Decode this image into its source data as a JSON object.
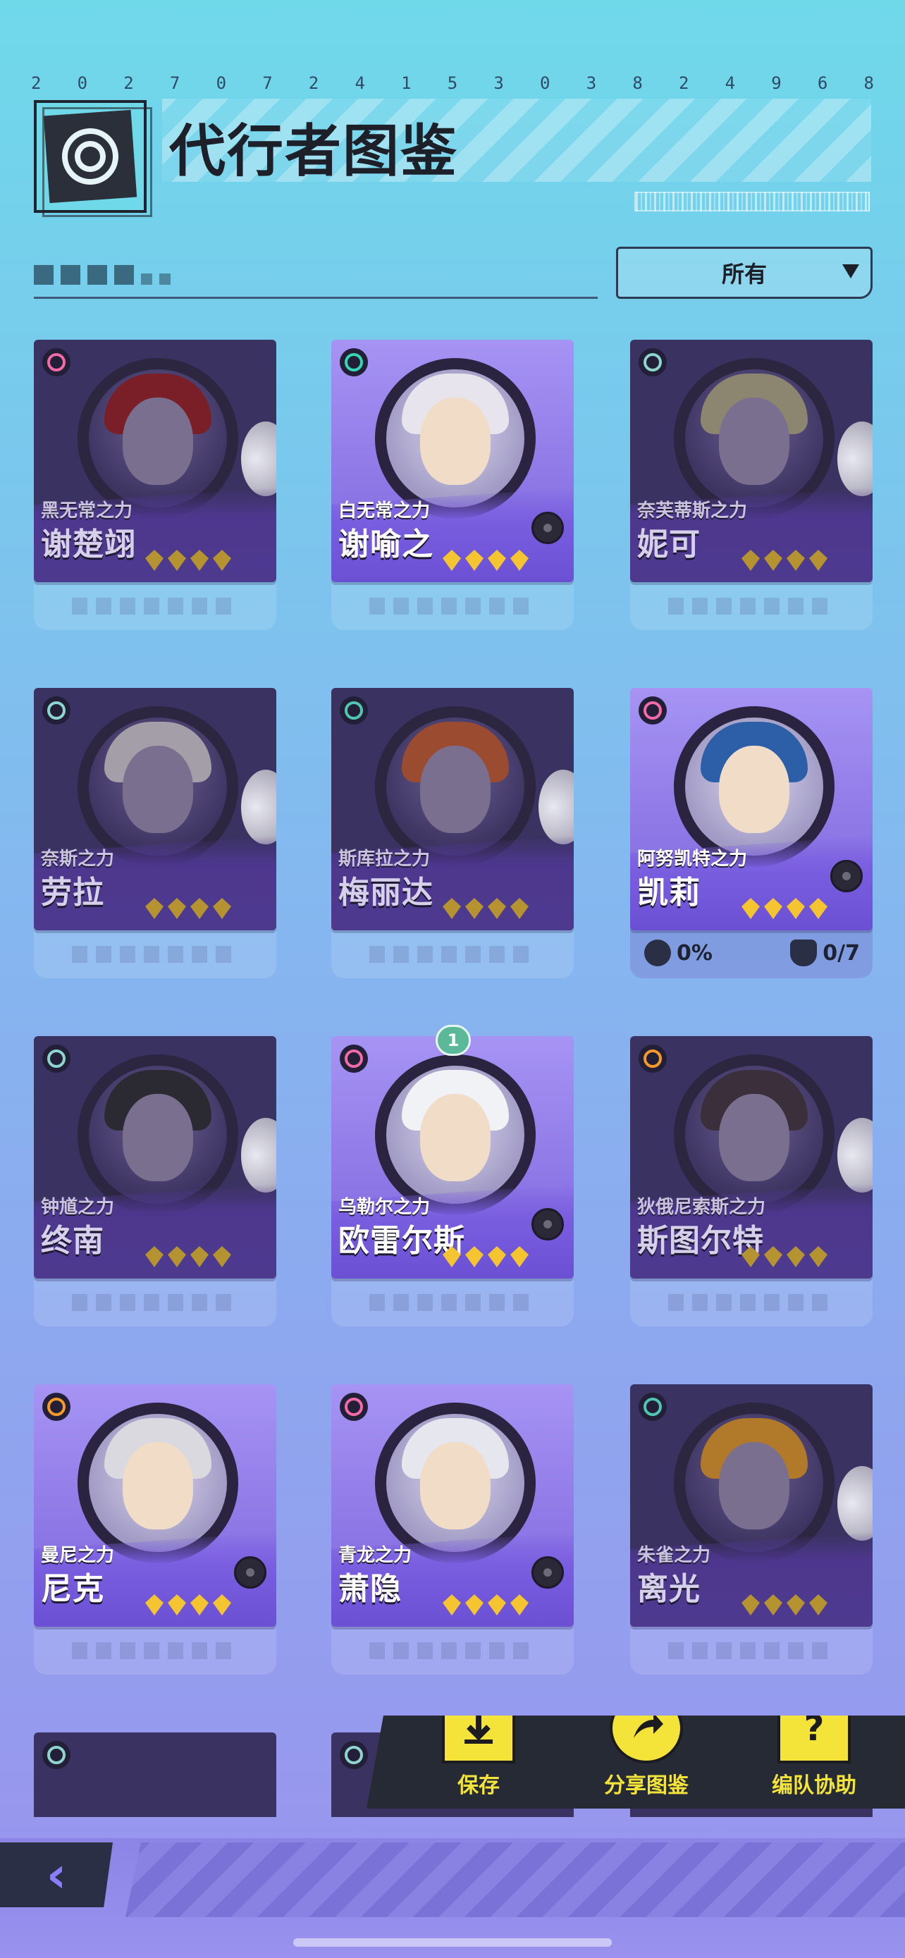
{
  "header": {
    "code": [
      "2",
      "0",
      "2",
      "7",
      "0",
      "7",
      "2",
      "4",
      "1",
      "5",
      "3",
      "0",
      "3",
      "8",
      "2",
      "4",
      "9",
      "6",
      "8"
    ],
    "title": "代行者图鉴"
  },
  "filter": {
    "selected": "所有"
  },
  "cards": [
    {
      "power": "黑无常之力",
      "name": "谢楚翊",
      "owned": false,
      "element": "pink",
      "hair": "#7a1f28"
    },
    {
      "power": "白无常之力",
      "name": "谢喻之",
      "owned": true,
      "element": "green",
      "hair": "#e8e4ee"
    },
    {
      "power": "奈芙蒂斯之力",
      "name": "妮可",
      "owned": false,
      "element": "x",
      "hair": "#8c8670"
    },
    {
      "power": "奈斯之力",
      "name": "劳拉",
      "owned": false,
      "element": "x",
      "hair": "#a49ea8"
    },
    {
      "power": "斯库拉之力",
      "name": "梅丽达",
      "owned": false,
      "element": "teal",
      "hair": "#9a4b30"
    },
    {
      "power": "阿努凯特之力",
      "name": "凯莉",
      "owned": true,
      "element": "pink",
      "hair": "#2c5fa8"
    },
    {
      "power": "钟馗之力",
      "name": "终南",
      "owned": false,
      "element": "x",
      "hair": "#2b2a32"
    },
    {
      "power": "乌勒尔之力",
      "name": "欧雷尔斯",
      "owned": true,
      "element": "pink",
      "hair": "#f0f2f6"
    },
    {
      "power": "狄俄尼索斯之力",
      "name": "斯图尔特",
      "owned": false,
      "element": "orange",
      "hair": "#3a2f3a"
    },
    {
      "power": "曼尼之力",
      "name": "尼克",
      "owned": true,
      "element": "orange",
      "hair": "#d9d9df"
    },
    {
      "power": "青龙之力",
      "name": "萧隐",
      "owned": true,
      "element": "pink",
      "hair": "#e6e6ee"
    },
    {
      "power": "朱雀之力",
      "name": "离光",
      "owned": false,
      "element": "teal",
      "hair": "#b07a2a"
    }
  ],
  "kelly_stats": {
    "progress": "0%",
    "count": "0/7"
  },
  "level_badge": "1",
  "actions": [
    {
      "label": "保存",
      "icon": "save-folder-icon"
    },
    {
      "label": "分享图鉴",
      "icon": "share-icon"
    },
    {
      "label": "编队协助",
      "icon": "team-cards-icon"
    }
  ],
  "nav": {
    "back_glyph": "‹"
  }
}
